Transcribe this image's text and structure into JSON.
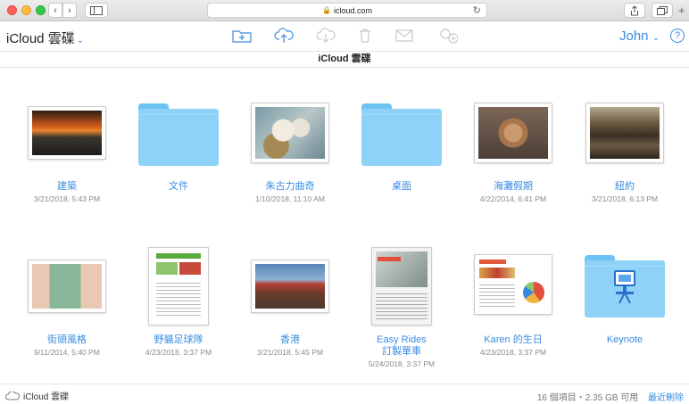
{
  "browser": {
    "url": "icloud.com"
  },
  "app": {
    "brand": "iCloud",
    "section": "雲碟",
    "user": "John",
    "help": "?",
    "title": "iCloud 雲碟"
  },
  "items": [
    {
      "name": "建築",
      "date": "3/21/2018, 5:43 PM",
      "kind": "photo"
    },
    {
      "name": "文件",
      "date": "",
      "kind": "folder"
    },
    {
      "name": "朱古力曲奇",
      "date": "1/10/2018, 11:10 AM",
      "kind": "photo"
    },
    {
      "name": "桌面",
      "date": "",
      "kind": "folder"
    },
    {
      "name": "海灘假期",
      "date": "4/22/2014, 6:41 PM",
      "kind": "photo"
    },
    {
      "name": "紐約",
      "date": "3/21/2018, 6:13 PM",
      "kind": "photo"
    },
    {
      "name": "街頭風格",
      "date": "9/11/2014, 5:40 PM",
      "kind": "photo"
    },
    {
      "name": "野貓足球隊",
      "date": "4/23/2018, 3:37 PM",
      "kind": "document"
    },
    {
      "name": "香港",
      "date": "3/21/2018, 5:45 PM",
      "kind": "photo"
    },
    {
      "name": "Easy Rides",
      "name2": "訂製單車",
      "date": "5/24/2018, 3:37 PM",
      "kind": "document"
    },
    {
      "name": "Karen 的生日",
      "date": "4/23/2018, 3:37 PM",
      "kind": "document"
    },
    {
      "name": "Keynote",
      "date": "",
      "kind": "app-folder"
    }
  ],
  "footer": {
    "location": "iCloud 雲碟",
    "summary": "16 個項目・2.35 GB 可用",
    "recently_deleted": "最近刪除"
  },
  "colors": {
    "accent": "#3a8be0",
    "folder": "#8ed2f8"
  }
}
